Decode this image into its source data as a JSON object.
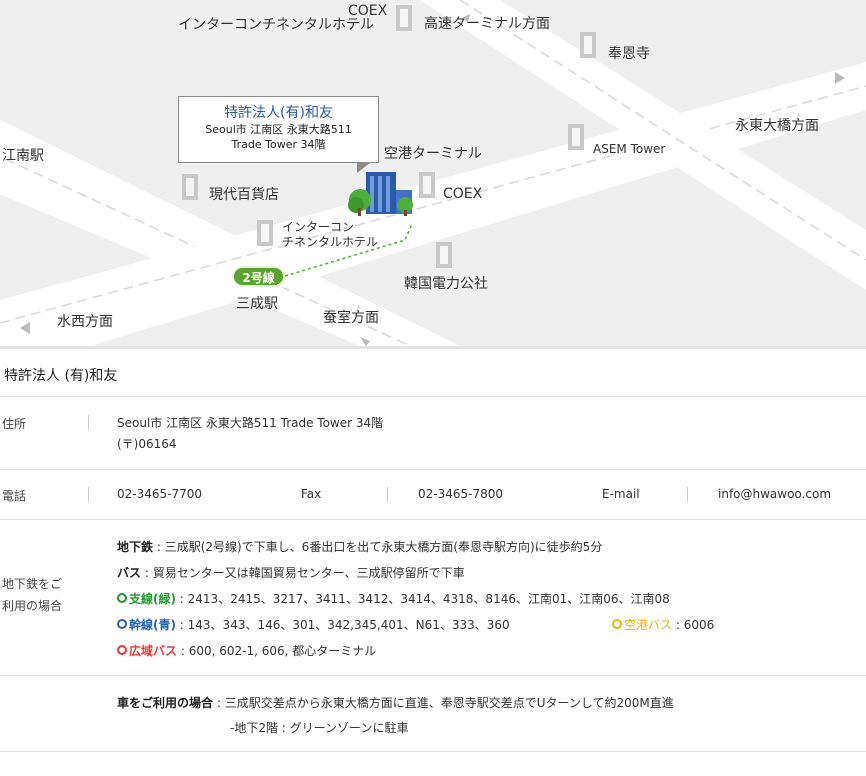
{
  "map": {
    "callout": {
      "name": "特許法人(有)和友",
      "address_line1": "Seoul市 江南区 永東大路511",
      "address_line2": "Trade Tower 34階"
    },
    "line_badge": "2号線",
    "labels": {
      "coex_top": "COEX",
      "intercon_top": "インターコンチネンタルホテル",
      "highway_terminal": "高速ターミナル方面",
      "bongeunsa": "奉恩寺",
      "yeongdong_bridge": "永東大橋方面",
      "asem_tower": "ASEM Tower",
      "gangnam_station": "江南駅",
      "airport_terminal": "空港ターミナル",
      "hyundai_dept": "現代百貨店",
      "coex_mid": "COEX",
      "intercon_line1": "インターコン",
      "intercon_line2": "チネンタルホテル",
      "kepco": "韓国電力公社",
      "samseong_station": "三成駅",
      "suseo": "水西方面",
      "jamsil": "蚕室方面"
    }
  },
  "info": {
    "company": "特許法人 (有)和友",
    "address": {
      "label": "住所",
      "line1": "Seoul市 江南区 永東大路511 Trade Tower 34階",
      "line2": "(〒)06164"
    },
    "phone": {
      "label": "電話",
      "tel": "02-3465-7700",
      "fax_label": "Fax",
      "fax": "02-3465-7800",
      "email_label": "E-mail",
      "email": "info@hwawoo.com"
    },
    "subway": {
      "label_line1": "地下鉄をご",
      "label_line2": "利用の場合",
      "subway_key": "地下鉄",
      "subway_text": " : 三成駅(2号線)で下車し、6番出口を出て永東大橋方面(奉恩寺駅方向)に徒歩約5分",
      "bus_key": "バス",
      "bus_text": " : 貿易センター又は韓国貿易センター、三成駅停留所で下車",
      "green_key": "支線(緑)",
      "green_text": " : 2413、2415、3217、3411、3412、3414、4318、8146、江南01、江南06、江南08",
      "blue_key": "幹線(青)",
      "blue_text": " : 143、343、146、301、342,345,401、N61、333、360",
      "airport_key": "空港バス",
      "airport_text": " : 6006",
      "red_key": "広域バス",
      "red_text": " : 600, 602-1, 606, 都心ターミナル"
    },
    "car": {
      "key": "車をご利用の場合",
      "text1": " : 三成駅交差点から永東大橋方面に直進、奉恩寺駅交差点でUターンして約200M直進",
      "text2": "-地下2階 : グリーンゾーンに駐車"
    }
  },
  "colors": {
    "callout_title": "#2b5aa8",
    "line2_badge": "#5aa52b",
    "branch_bus": "#1e9a2a",
    "trunk_bus": "#2364b4",
    "airport_bus": "#e6b40b",
    "wide_bus": "#e53a3a"
  }
}
